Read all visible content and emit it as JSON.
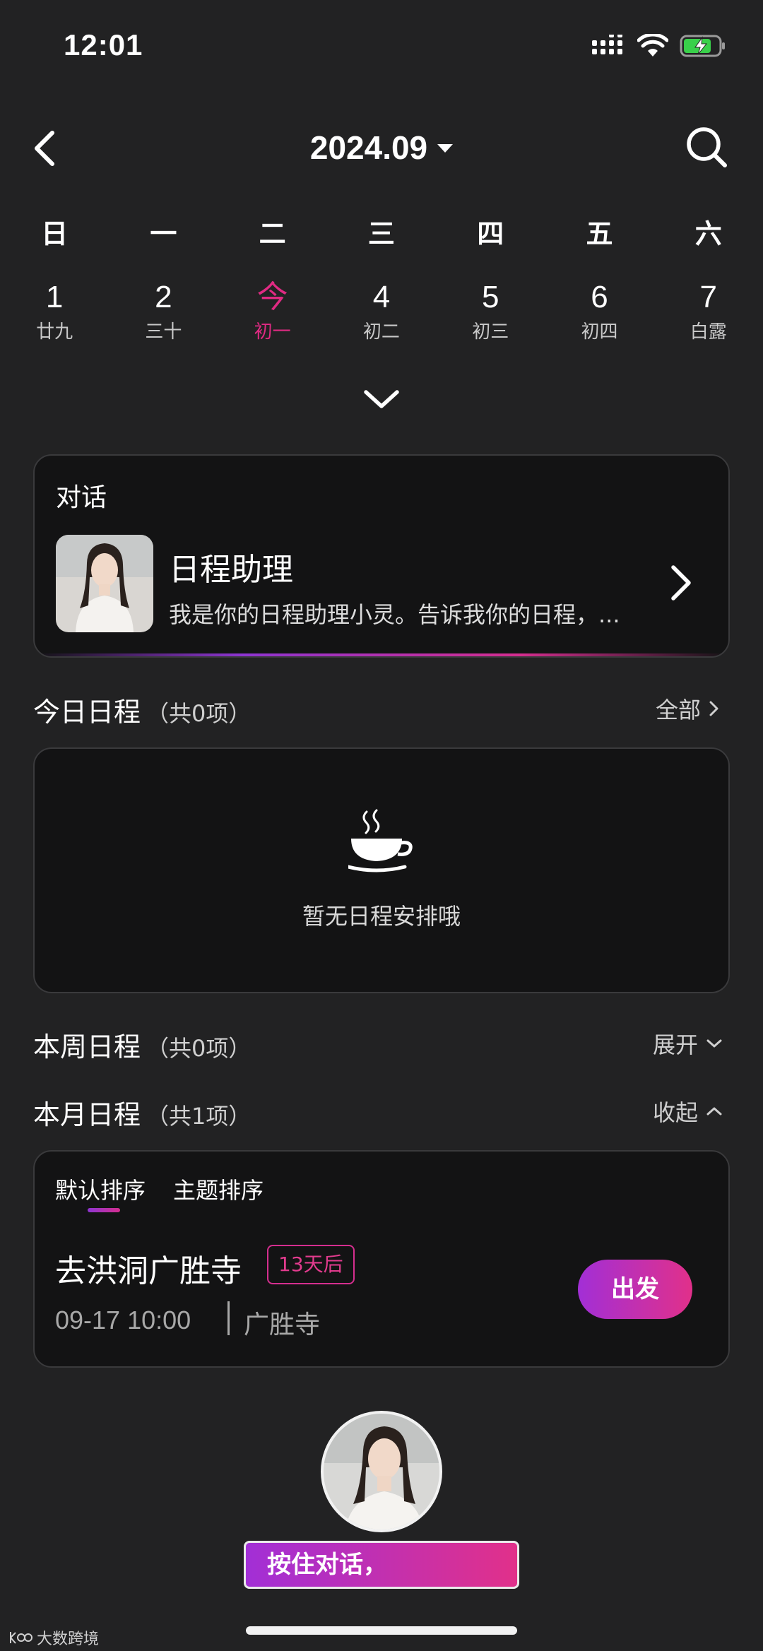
{
  "status_bar": {
    "time": "12:01"
  },
  "header": {
    "month": "2024.09"
  },
  "week": {
    "weekdays": [
      "日",
      "一",
      "二",
      "三",
      "四",
      "五",
      "六"
    ],
    "days": [
      {
        "num": "1",
        "lunar": "廿九"
      },
      {
        "num": "2",
        "lunar": "三十"
      },
      {
        "num": "今",
        "lunar": "初一"
      },
      {
        "num": "4",
        "lunar": "初二"
      },
      {
        "num": "5",
        "lunar": "初三"
      },
      {
        "num": "6",
        "lunar": "初四"
      },
      {
        "num": "7",
        "lunar": "白露"
      }
    ]
  },
  "chat": {
    "heading": "对话",
    "name": "日程助理",
    "preview": "我是你的日程助理小灵。告诉我你的日程，..."
  },
  "today": {
    "title": "今日日程",
    "count": "（共0项）",
    "link": "全部",
    "empty_text": "暂无日程安排哦"
  },
  "week_section": {
    "title": "本周日程",
    "count": "（共0项）",
    "link": "展开"
  },
  "month_section": {
    "title": "本月日程",
    "count": "（共1项）",
    "link": "收起"
  },
  "month_card": {
    "sort_default": "默认排序",
    "sort_topic": "主题排序",
    "event": {
      "title": "去洪洞广胜寺",
      "badge": "13天后",
      "time": "09-17 10:00",
      "place": "广胜寺",
      "action": "出发"
    }
  },
  "bottom": {
    "talk_button": "按住对话，"
  },
  "watermark": "大数跨境",
  "colors": {
    "accent_pink": "#e02a83",
    "accent_purple": "#a22fd6",
    "background": "#222223",
    "card": "#131314"
  }
}
